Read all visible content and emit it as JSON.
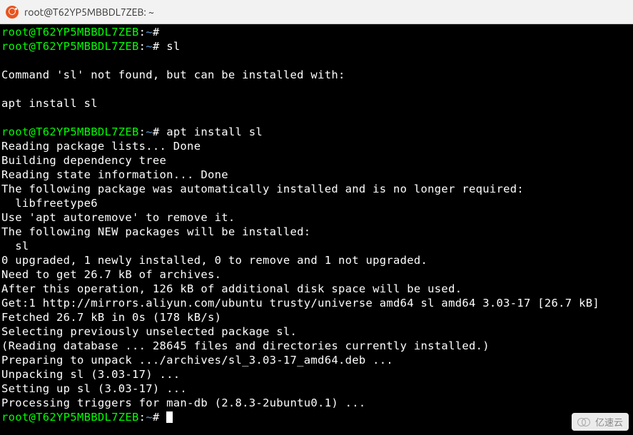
{
  "window": {
    "title": "root@T62YP5MBBDL7ZEB: ~"
  },
  "prompt": {
    "user_host": "root@T62YP5MBBDL7ZEB",
    "colon": ":",
    "path": "~",
    "symbol": "# "
  },
  "lines": [
    {
      "type": "prompt",
      "cmd": ""
    },
    {
      "type": "prompt",
      "cmd": "sl"
    },
    {
      "type": "blank"
    },
    {
      "type": "out",
      "text": "Command 'sl' not found, but can be installed with:"
    },
    {
      "type": "blank"
    },
    {
      "type": "out",
      "text": "apt install sl"
    },
    {
      "type": "blank"
    },
    {
      "type": "prompt",
      "cmd": "apt install sl"
    },
    {
      "type": "out",
      "text": "Reading package lists... Done"
    },
    {
      "type": "out",
      "text": "Building dependency tree"
    },
    {
      "type": "out",
      "text": "Reading state information... Done"
    },
    {
      "type": "out",
      "text": "The following package was automatically installed and is no longer required:"
    },
    {
      "type": "out",
      "text": "  libfreetype6"
    },
    {
      "type": "out",
      "text": "Use 'apt autoremove' to remove it."
    },
    {
      "type": "out",
      "text": "The following NEW packages will be installed:"
    },
    {
      "type": "out",
      "text": "  sl"
    },
    {
      "type": "out",
      "text": "0 upgraded, 1 newly installed, 0 to remove and 1 not upgraded."
    },
    {
      "type": "out",
      "text": "Need to get 26.7 kB of archives."
    },
    {
      "type": "out",
      "text": "After this operation, 126 kB of additional disk space will be used."
    },
    {
      "type": "out",
      "text": "Get:1 http://mirrors.aliyun.com/ubuntu trusty/universe amd64 sl amd64 3.03-17 [26.7 kB]"
    },
    {
      "type": "out",
      "text": "Fetched 26.7 kB in 0s (178 kB/s)"
    },
    {
      "type": "out",
      "text": "Selecting previously unselected package sl."
    },
    {
      "type": "out",
      "text": "(Reading database ... 28645 files and directories currently installed.)"
    },
    {
      "type": "out",
      "text": "Preparing to unpack .../archives/sl_3.03-17_amd64.deb ..."
    },
    {
      "type": "out",
      "text": "Unpacking sl (3.03-17) ..."
    },
    {
      "type": "out",
      "text": "Setting up sl (3.03-17) ..."
    },
    {
      "type": "out",
      "text": "Processing triggers for man-db (2.8.3-2ubuntu0.1) ..."
    },
    {
      "type": "prompt",
      "cmd": "",
      "cursor": true
    }
  ],
  "watermark": {
    "text": "亿速云"
  }
}
